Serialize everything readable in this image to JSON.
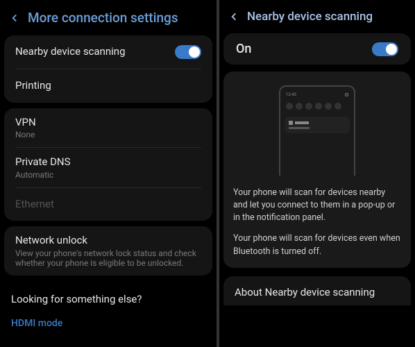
{
  "left": {
    "title": "More connection settings",
    "rows": {
      "nearby": "Nearby device scanning",
      "printing": "Printing",
      "vpn": "VPN",
      "vpn_sub": "None",
      "dns": "Private DNS",
      "dns_sub": "Automatic",
      "ethernet": "Ethernet",
      "network_unlock": "Network unlock",
      "network_unlock_sub": "View your phone's network lock status and check whether your phone is eligible to be unlocked."
    },
    "footer": {
      "label": "Looking for something else?",
      "link": "HDMI mode"
    }
  },
  "right": {
    "title": "Nearby device scanning",
    "status": "On",
    "desc1": "Your phone will scan for devices nearby and let you connect to them in a pop-up or in the notification panel.",
    "desc2": "Your phone will scan for devices even when Bluetooth is turned off.",
    "about": "About Nearby device scanning",
    "mock_time": "12:45"
  }
}
